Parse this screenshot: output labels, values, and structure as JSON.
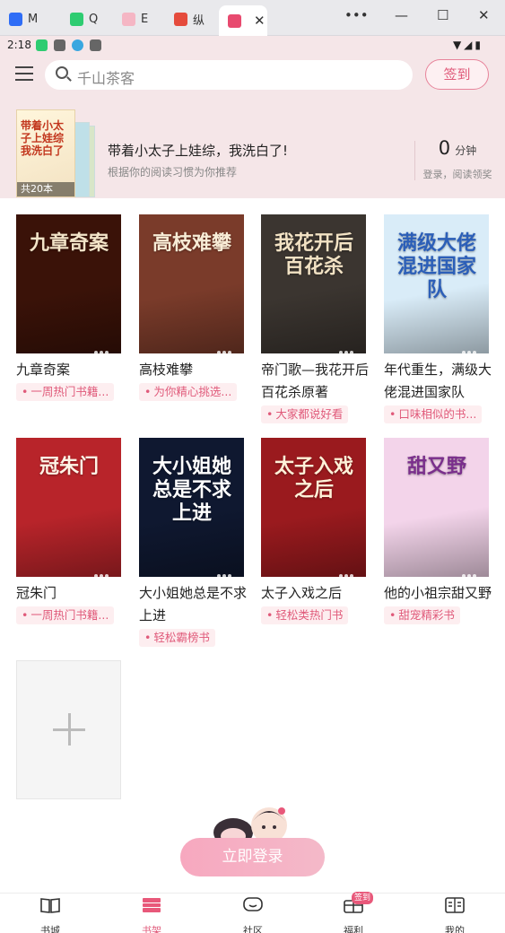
{
  "browser": {
    "tabs": [
      {
        "label": "M",
        "color": "#2f6df6"
      },
      {
        "label": "Q",
        "color": "#2ecc71"
      },
      {
        "label": "E",
        "color": "#f5b6c4"
      },
      {
        "label": "纵",
        "color": "#e54b3c"
      },
      {
        "label": "",
        "color": "#e84a6f"
      }
    ],
    "more": "•••",
    "minimize": "—",
    "maximize": "☐",
    "close": "✕"
  },
  "status": {
    "time": "2:18",
    "right": "▼◢▮"
  },
  "header": {
    "search_placeholder": "千山茶客",
    "signin_label": "签到"
  },
  "banner": {
    "title": "带着小太子上娃综，我洗白了!",
    "subtitle": "根据你的阅读习惯为你推荐",
    "cover_title": "带着小太子上娃综我洗白了",
    "count_label": "共20本",
    "minutes_value": "0",
    "minutes_unit": "分钟",
    "note": "登录，阅读领奖"
  },
  "books": [
    {
      "title": "九章奇案",
      "tag": "一周热门书籍...",
      "cover_text": "九章奇案",
      "bg": "#3a1208",
      "fg": "#f3e4c8"
    },
    {
      "title": "高枝难攀",
      "tag": "为你精心挑选...",
      "cover_text": "高枝难攀",
      "bg": "#7a3b2a",
      "fg": "#f8ecd6"
    },
    {
      "title": "帝门歌—我花开后百花杀原著",
      "tag": "大家都说好看",
      "cover_text": "我花开后百花杀",
      "bg": "#3b3530",
      "fg": "#f2e2c4"
    },
    {
      "title": "年代重生，满级大佬混进国家队",
      "tag": "口味相似的书...",
      "cover_text": "满级大佬混进国家队",
      "bg": "#d9ecf8",
      "fg": "#2c5fb8"
    },
    {
      "title": "冠朱门",
      "tag": "一周热门书籍...",
      "cover_text": "冠朱门",
      "bg": "#b8242a",
      "fg": "#fff4e6"
    },
    {
      "title": "大小姐她总是不求上进",
      "tag": "轻松霸榜书",
      "cover_text": "大小姐她总是不求上进",
      "bg": "#0f1830",
      "fg": "#ffffff"
    },
    {
      "title": "太子入戏之后",
      "tag": "轻松类热门书",
      "cover_text": "太子入戏之后",
      "bg": "#9a1a1e",
      "fg": "#fff1d8"
    },
    {
      "title": "他的小祖宗甜又野",
      "tag": "甜宠精彩书",
      "cover_text": "甜又野",
      "bg": "#f3d4ea",
      "fg": "#7a2f8c"
    }
  ],
  "login_label": "立即登录",
  "nav": {
    "items": [
      "书城",
      "书架",
      "社区",
      "福利",
      "我的"
    ],
    "badge": "签到"
  },
  "colors": {
    "accent": "#e05a7a",
    "header_bg": "#f5e6e8"
  }
}
